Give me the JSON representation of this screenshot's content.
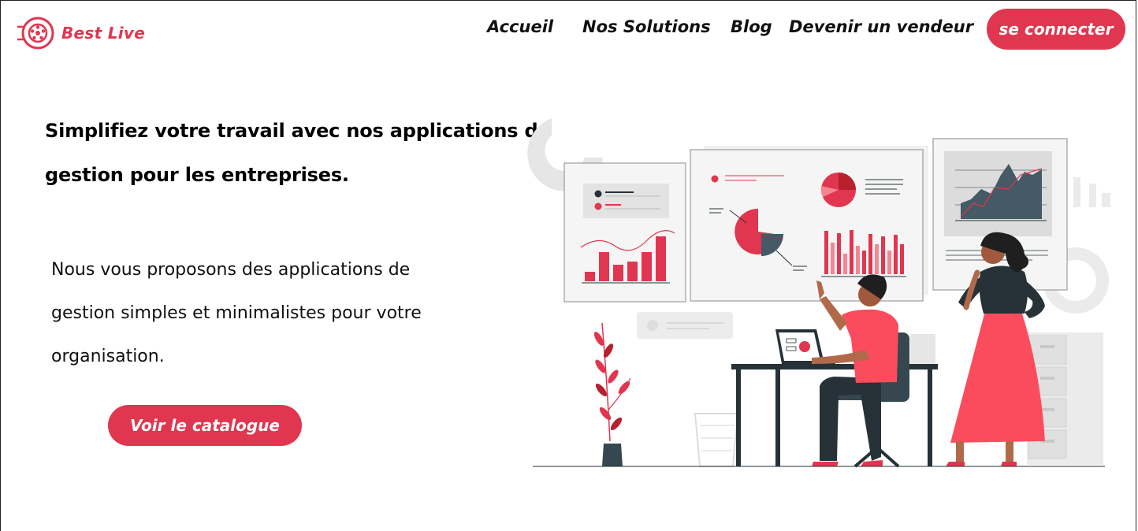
{
  "brand": {
    "name": "Best Live",
    "color": "#e0364f",
    "icon": "film-reel-icon"
  },
  "nav": {
    "items": [
      "Accueil",
      "Nos Solutions",
      "Blog",
      "Devenir un vendeur"
    ],
    "login_label": "se connecter"
  },
  "hero": {
    "title_line1": "Simplifiez votre travail avec nos applications de",
    "title_line2": "gestion pour les entreprises.",
    "sub_line1": "Nous vous proposons des applications de",
    "sub_line2": "gestion simples et minimalistes pour votre",
    "sub_line3": "organisation.",
    "cta_label": "Voir le catalogue"
  },
  "colors": {
    "accent": "#e0364f",
    "dark": "#263238",
    "light_gray": "#ebebeb"
  }
}
